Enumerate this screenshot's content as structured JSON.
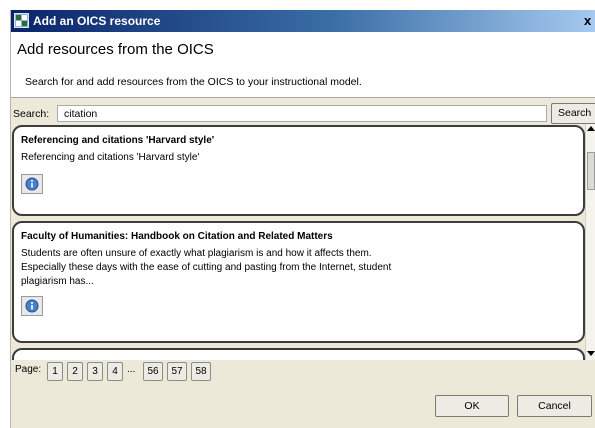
{
  "window": {
    "title": "Add an OICS resource",
    "close_glyph": "x"
  },
  "header": {
    "title": "Add resources from the OICS",
    "subtitle": "Search for and add resources from the OICS to your instructional model."
  },
  "search": {
    "label": "Search:",
    "value": "citation",
    "button_label": "Search"
  },
  "results": [
    {
      "title": "Referencing and citations 'Harvard style'",
      "description": "Referencing and citations 'Harvard style'",
      "icon": "info-icon"
    },
    {
      "title": "Faculty of Humanities: Handbook on Citation and Related Matters",
      "description": "Students are often unsure of exactly what plagiarism is and how it affects them.\nEspecially these days with the ease of cutting and pasting from the Internet, student\nplagiarism has...",
      "icon": "info-icon"
    }
  ],
  "pager": {
    "label": "Page:",
    "pages_before": [
      "1",
      "2",
      "3",
      "4"
    ],
    "ellipsis": "...",
    "pages_after": [
      "56",
      "57",
      "58"
    ]
  },
  "footer": {
    "ok_label": "OK",
    "cancel_label": "Cancel"
  },
  "colors": {
    "titlebar_start": "#0a246a",
    "titlebar_end": "#a6caf0",
    "dialog_background": "#ece9d8",
    "card_border": "#3c3c3c"
  }
}
